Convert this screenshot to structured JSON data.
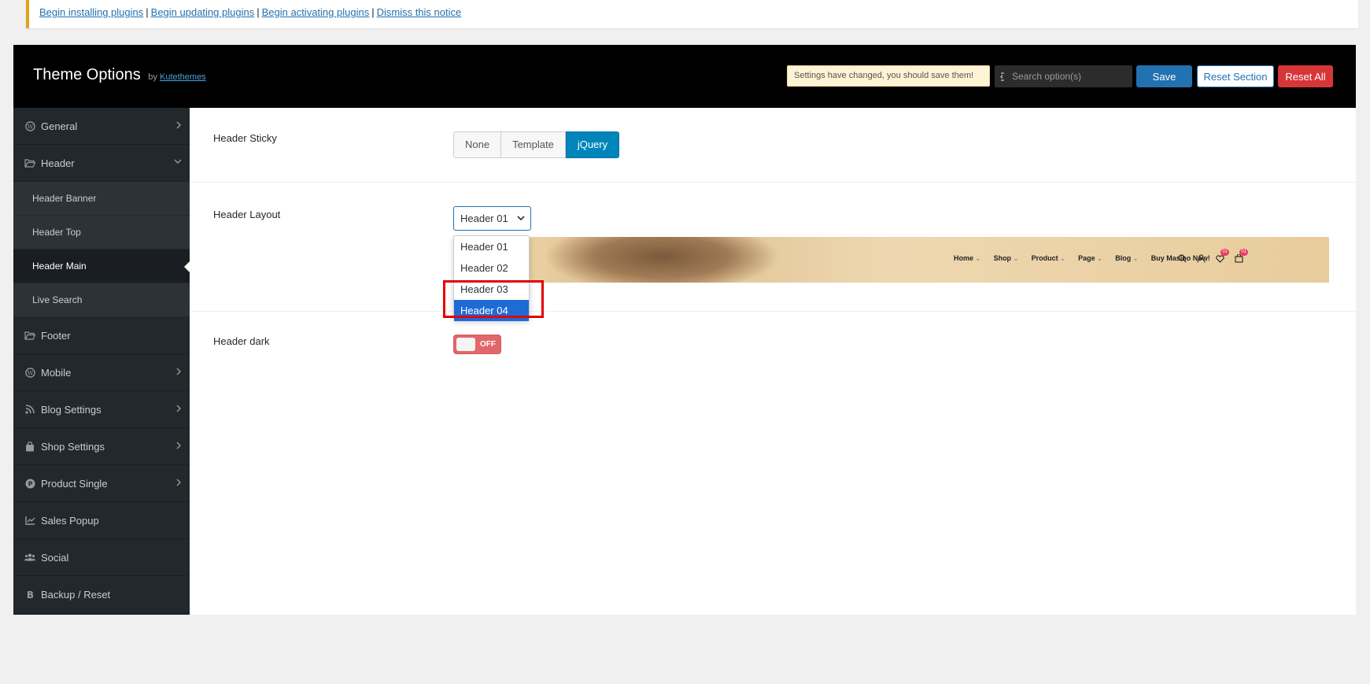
{
  "notice": {
    "links": [
      "Begin installing plugins",
      "Begin updating plugins",
      "Begin activating plugins",
      "Dismiss this notice"
    ],
    "separator": "|"
  },
  "topbar": {
    "title": "Theme Options",
    "by": "by",
    "author": "Kutethemes",
    "changed_notice": "Settings have changed, you should save them!",
    "search_placeholder": "Search option(s)",
    "save_label": "Save",
    "reset_section_label": "Reset Section",
    "reset_all_label": "Reset All"
  },
  "sidebar": {
    "items": [
      {
        "label": "General",
        "icon": "wordpress-icon"
      },
      {
        "label": "Header",
        "icon": "folder-open-icon"
      },
      {
        "label": "Header Banner"
      },
      {
        "label": "Header Top"
      },
      {
        "label": "Header Main"
      },
      {
        "label": "Live Search"
      },
      {
        "label": "Footer",
        "icon": "folder-open-icon"
      },
      {
        "label": "Mobile",
        "icon": "wordpress-icon"
      },
      {
        "label": "Blog Settings",
        "icon": "rss-icon"
      },
      {
        "label": "Shop Settings",
        "icon": "shopping-bag-icon"
      },
      {
        "label": "Product Single",
        "icon": "product-hunt-icon"
      },
      {
        "label": "Sales Popup",
        "icon": "line-chart-icon"
      },
      {
        "label": "Social",
        "icon": "users-icon"
      },
      {
        "label": "Backup / Reset",
        "icon": "bold-b-icon"
      }
    ]
  },
  "fields": {
    "header_sticky": {
      "label": "Header Sticky",
      "options": [
        "None",
        "Template",
        "jQuery"
      ],
      "selected": "jQuery"
    },
    "header_layout": {
      "label": "Header Layout",
      "value": "Header 01",
      "options": [
        "Header 01",
        "Header 02",
        "Header 03",
        "Header 04"
      ],
      "highlighted": "Header 04",
      "preview_menu": [
        "Home",
        "Shop",
        "Product",
        "Page",
        "Blog",
        "Buy Masino Now!"
      ],
      "preview_badges": [
        "01",
        "01"
      ]
    },
    "header_dark": {
      "label": "Header dark",
      "toggle_text": "OFF"
    }
  },
  "colors": {
    "accent": "#2271b1",
    "danger": "#d63638",
    "sidebar_bg": "#23282d",
    "highlight_box": "#e50000"
  }
}
